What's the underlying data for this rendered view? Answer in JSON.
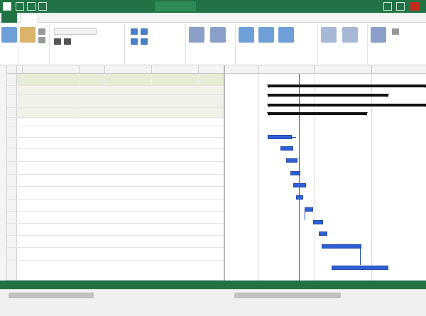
{
  "colors": {
    "accent": "#217346",
    "selected_row": "#e7ecd5",
    "task_bar": "#2f5fd4",
    "summary_bar": "#111111",
    "today_line": "#2b7a2b"
  },
  "icons": [
    "save-icon",
    "undo-icon",
    "redo-icon",
    "paste-icon",
    "cut-icon",
    "copy-icon",
    "gantt-chart-icon",
    "task-mode-icon",
    "link-icon",
    "unlink-icon",
    "indent-icon",
    "outdent-icon",
    "milestone-icon",
    "summary-icon",
    "scroll-to-task-icon",
    "minimize-icon",
    "maximize-icon",
    "close-icon"
  ]
}
